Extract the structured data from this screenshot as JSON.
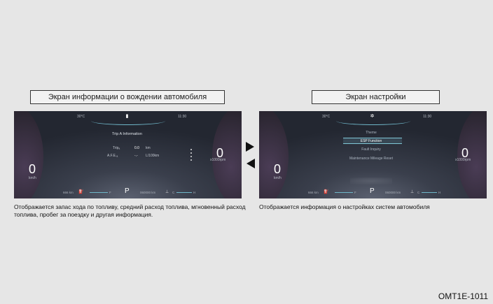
{
  "left_panel": {
    "caption": "Экран информации о вождении автомобиля",
    "screen": {
      "temperature": "30°C",
      "clock": "11:30",
      "top_icon": "trip-info-icon",
      "menu_title": "Trip A Information",
      "rows": [
        {
          "label": "Tripₐ",
          "value": "0.0",
          "unit": "km"
        },
        {
          "label": "A.F.E.ₐ",
          "value": "-.-",
          "unit": "L/100km"
        }
      ],
      "speed": "0",
      "speed_unit": "km/h",
      "rpm": "0",
      "rpm_unit": "x1000rpm",
      "range": "666 km",
      "fuel_icon": "fuel-icon",
      "fuel_scale": "F",
      "gear": "P",
      "odometer": "060000 km",
      "temp_icon": "coolant-temp-icon",
      "temp_scale_left": "C",
      "temp_scale_right": "H"
    },
    "description": "Отображается запас хода по топливу, средний расход топлива, мгновенный расход топлива, пробег за поездку и другая информация."
  },
  "right_panel": {
    "caption": "Экран настройки",
    "screen": {
      "temperature": "30°C",
      "clock": "11:30",
      "top_icon": "settings-icon",
      "menu_items": [
        "Theme",
        "ESP Function",
        "Fault Inquiry",
        "Maintenance Mileage Reset"
      ],
      "selected_item": "ESP Function",
      "speed": "0",
      "speed_unit": "km/h",
      "rpm": "0",
      "rpm_unit": "x1000rpm",
      "range": "666 km",
      "fuel_icon": "fuel-icon",
      "fuel_scale": "F",
      "gear": "P",
      "odometer": "060000 km",
      "temp_icon": "coolant-temp-icon",
      "temp_scale_left": "C",
      "temp_scale_right": "H"
    },
    "description": "Отображается информация о настройках систем автомобиля"
  },
  "arrows": [
    "arrow-right-icon",
    "arrow-left-icon"
  ],
  "figure_code": "OMT1E-1011",
  "colors": {
    "page_background": "#e6e6e6",
    "screen_accent": "#6fb7c9"
  }
}
